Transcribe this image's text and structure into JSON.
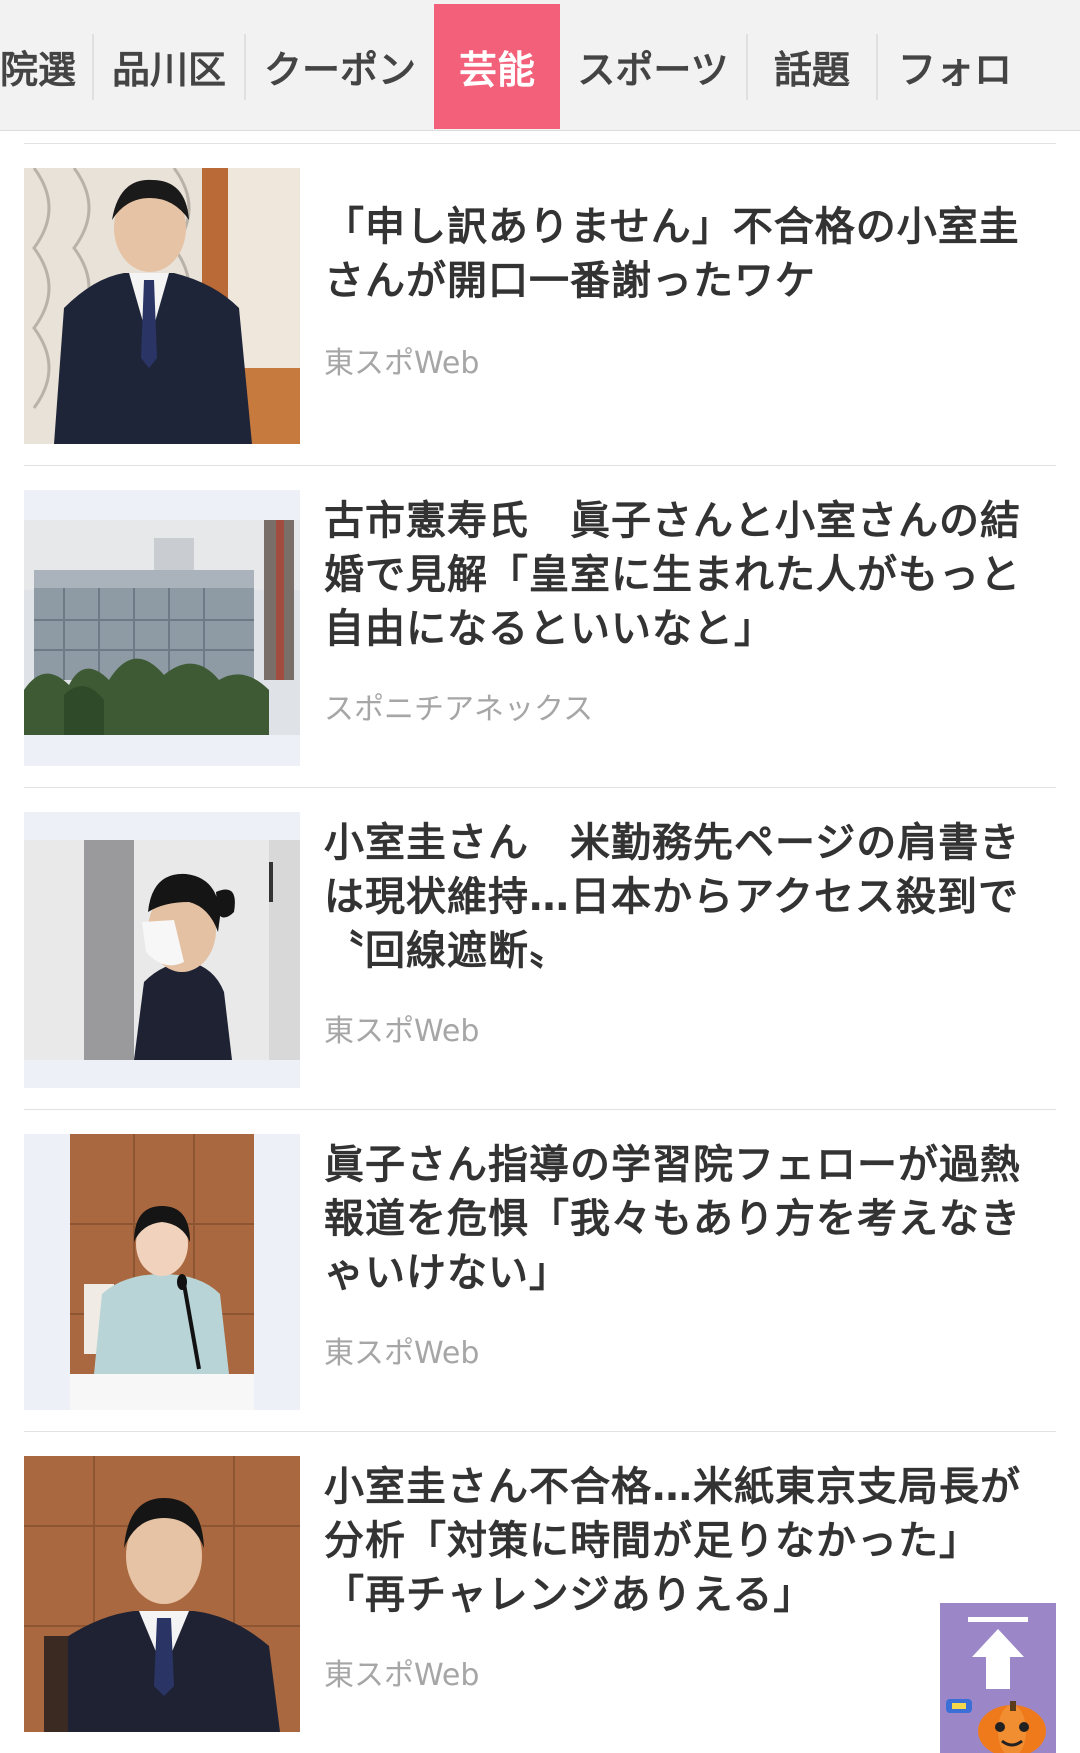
{
  "tabs": [
    {
      "label": "院選",
      "active": false
    },
    {
      "label": "品川区",
      "active": false
    },
    {
      "label": "クーポン",
      "active": false
    },
    {
      "label": "芸能",
      "active": true
    },
    {
      "label": "スポーツ",
      "active": false
    },
    {
      "label": "話題",
      "active": false
    },
    {
      "label": "フォロ",
      "active": false
    }
  ],
  "articles": [
    {
      "headline_lines": [
        "「申し訳ありません」不合格の小室圭",
        "さんが開口一番謝ったワケ"
      ],
      "source": "東スポWeb",
      "thumbnail": "man-in-suit-standing-photo"
    },
    {
      "headline_lines": [
        "古市憲寿氏　眞子さんと小室さんの結",
        "婚で見解「皇室に生まれた人がもっと",
        "自由になるといいなと」"
      ],
      "source": "スポニチアネックス",
      "thumbnail": "building-exterior-photo"
    },
    {
      "headline_lines": [
        "小室圭さん　米勤務先ページの肩書き",
        "は現状維持…日本からアクセス殺到で",
        "〝回線遮断〟"
      ],
      "source": "東スポWeb",
      "thumbnail": "man-in-mask-profile-photo"
    },
    {
      "headline_lines": [
        "眞子さん指導の学習院フェローが過熱",
        "報道を危惧「我々もあり方を考えなき",
        "ゃいけない」"
      ],
      "source": "東スポWeb",
      "thumbnail": "woman-at-press-conference-photo"
    },
    {
      "headline_lines": [
        "小室圭さん不合格…米紙東京支局長が",
        "分析「対策に時間が足りなかった」",
        "「再チャレンジありえる」"
      ],
      "source": "東スポWeb",
      "thumbnail": "man-at-press-conference-photo"
    }
  ],
  "back_to_top": {
    "icon": "arrow-up-icon"
  },
  "colors": {
    "active_tab": "#f2607a",
    "headline": "#333333",
    "source": "#a6a6a6",
    "back_to_top": "#9b87c8"
  }
}
